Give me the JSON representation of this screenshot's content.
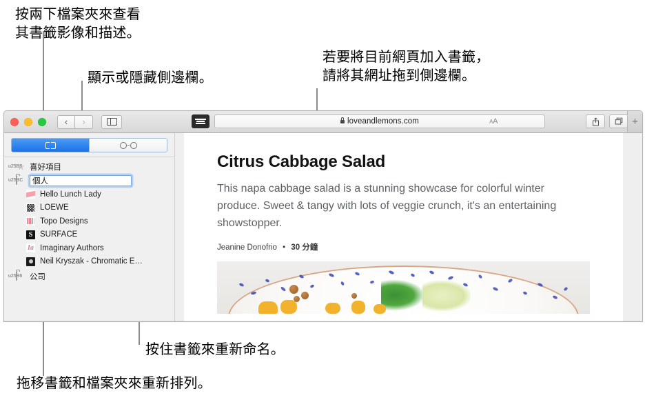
{
  "callouts": [
    {
      "id": "folder-hint",
      "text": "按兩下檔案夾來查看\n其書籤影像和描述。"
    },
    {
      "id": "sidebar-hint",
      "text": "顯示或隱藏側邊欄。"
    },
    {
      "id": "url-drag-hint",
      "text": "若要將目前網頁加入書籤，\n請將其網址拖到側邊欄。"
    },
    {
      "id": "rename-hint",
      "text": "按住書籤來重新命名。"
    },
    {
      "id": "reorder-hint",
      "text": "拖移書籤和檔案夾來重新排列。"
    }
  ],
  "window": {
    "traffic_lights": {
      "close": "close-button",
      "minimize": "minimize-button",
      "zoom": "zoom-button"
    },
    "nav": {
      "back": "‹",
      "forward": "›"
    },
    "sidebar_toggle_label": "sidebar-toggle",
    "reader_label": "reader-view",
    "address": {
      "url": "loveandlemons.com",
      "secure_icon": "lock-icon",
      "text_size_small": "A",
      "text_size_large": "A"
    },
    "right_buttons": {
      "share": "share-icon",
      "tab_overview": "tab-overview-icon",
      "new_tab": "+"
    }
  },
  "sidebar": {
    "segments": [
      {
        "id": "bookmarks",
        "icon": "book-icon",
        "selected": true
      },
      {
        "id": "reading-list",
        "icon": "glasses-icon",
        "selected": false
      }
    ],
    "tree": [
      {
        "type": "folder",
        "label": "喜好項目",
        "icon": "star-icon",
        "expanded": false,
        "editing": false
      },
      {
        "type": "folder",
        "label": "個人",
        "icon": "folder-icon",
        "expanded": true,
        "editing": true
      },
      {
        "type": "bookmark",
        "label": "Hello Lunch Lady",
        "favicon": "hello-lunch-lady-favicon"
      },
      {
        "type": "bookmark",
        "label": "LOEWE",
        "favicon": "loewe-favicon"
      },
      {
        "type": "bookmark",
        "label": "Topo Designs",
        "favicon": "topo-designs-favicon"
      },
      {
        "type": "bookmark",
        "label": "SURFACE",
        "favicon": "surface-favicon",
        "glyph": "S"
      },
      {
        "type": "bookmark",
        "label": "Imaginary Authors",
        "favicon": "imaginary-authors-favicon",
        "glyph": "Ia"
      },
      {
        "type": "bookmark",
        "label": "Neil Kryszak - Chromatic E…",
        "favicon": "neil-kryszak-favicon"
      },
      {
        "type": "folder",
        "label": "公司",
        "icon": "folder-icon",
        "expanded": false,
        "editing": false
      }
    ]
  },
  "article": {
    "title": "Citrus Cabbage Salad",
    "description": "This napa cabbage salad is a stunning showcase for colorful winter produce. Sweet & tangy with lots of veggie crunch, it's an entertaining showstopper.",
    "author": "Jeanine Donofrio",
    "separator": "•",
    "duration": "30 分鐘",
    "photo_alt": "citrus-cabbage-salad-photo"
  },
  "colors": {
    "accent": "#1a72e8",
    "selection_ring": "#6eaaf0",
    "traffic_red": "#ff5f57",
    "traffic_yellow": "#ffbd2e",
    "traffic_green": "#28c840",
    "leader": "#8b8b8b",
    "text": "#1b1b1b"
  }
}
